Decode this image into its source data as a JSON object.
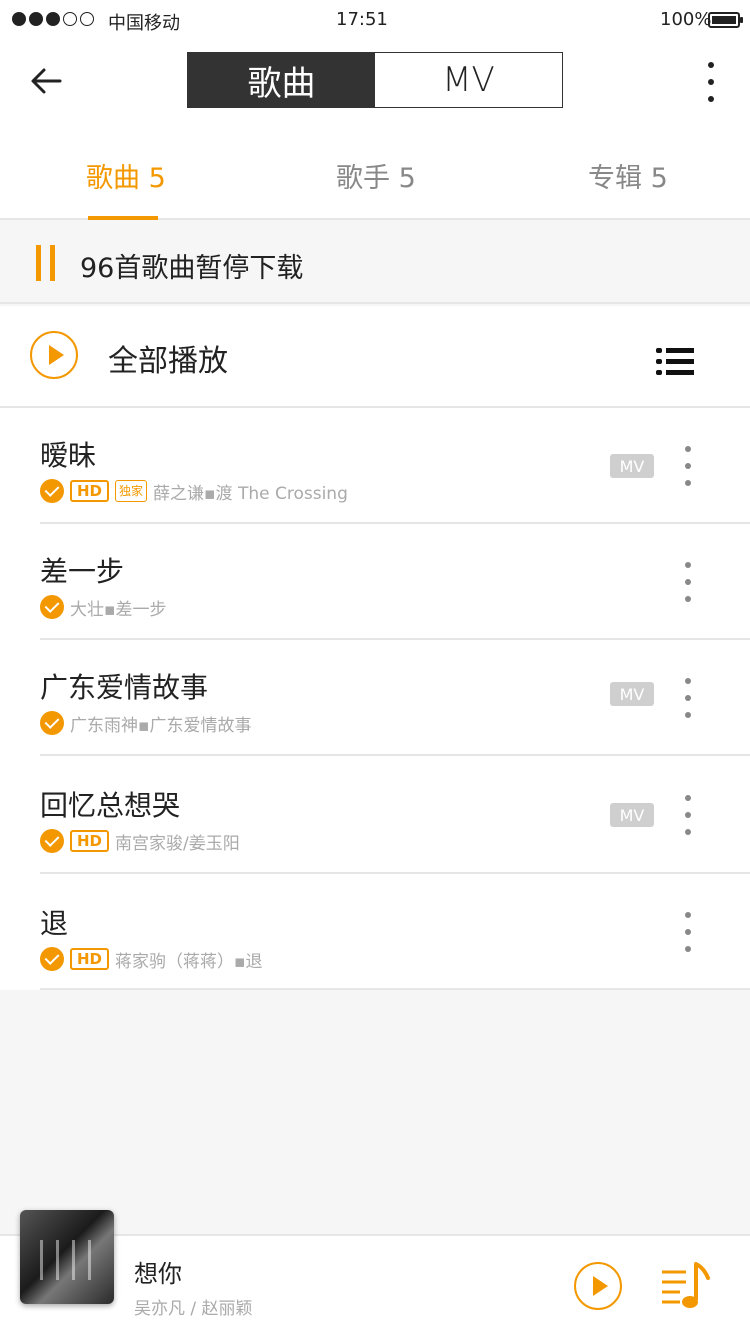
{
  "status_bar": {
    "carrier": "中国移动",
    "time": "17:51",
    "battery": "100%",
    "signal_bars_filled": 3,
    "signal_bars_total": 5
  },
  "header": {
    "segments": [
      {
        "label": "歌曲",
        "active": true
      },
      {
        "label": "MV",
        "active": false
      }
    ]
  },
  "tabs": [
    {
      "label": "歌曲 5",
      "active": true
    },
    {
      "label": "歌手 5",
      "active": false
    },
    {
      "label": "专辑 5",
      "active": false
    }
  ],
  "download_banner": {
    "text": "96首歌曲暂停下载"
  },
  "play_all": {
    "label": "全部播放"
  },
  "badges": {
    "hd": "HD",
    "exclusive": "独家",
    "mv": "MV"
  },
  "songs": [
    {
      "title": "暧昧",
      "artist": "薛之谦▪渡 The Crossing",
      "hd": true,
      "exclusive": true,
      "mv": true
    },
    {
      "title": "差一步",
      "artist": "大壮▪差一步",
      "hd": false,
      "exclusive": false,
      "mv": false
    },
    {
      "title": "广东爱情故事",
      "artist": "广东雨神▪广东爱情故事",
      "hd": false,
      "exclusive": false,
      "mv": true
    },
    {
      "title": "回忆总想哭",
      "artist": "南宫家骏/姜玉阳",
      "hd": true,
      "exclusive": false,
      "mv": true
    },
    {
      "title": "退",
      "artist": "蒋家驹（蒋蒋）▪退",
      "hd": true,
      "exclusive": false,
      "mv": false
    }
  ],
  "now_playing": {
    "title": "想你",
    "artist": "吴亦凡 / 赵丽颖"
  },
  "colors": {
    "accent": "#f39800",
    "segment_active_bg": "#333333",
    "mv_badge_bg": "#cfcfcf",
    "divider": "#e6e6e6",
    "page_bg": "#f6f6f6"
  },
  "icons": {
    "back": "arrow-left-icon",
    "more": "vertical-ellipsis-icon",
    "pause": "pause-icon",
    "play": "play-circle-icon",
    "list": "list-icon",
    "check": "check-circle-icon",
    "playlist": "music-note-list-icon"
  }
}
